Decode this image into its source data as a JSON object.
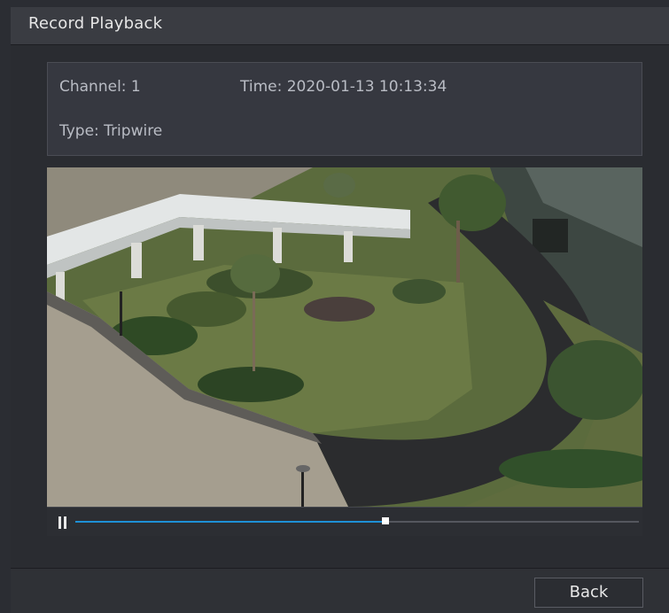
{
  "window": {
    "title": "Record Playback"
  },
  "info": {
    "channel": "Channel: 1",
    "time": "Time: 2020-01-13 10:13:34",
    "type": "Type: Tripwire"
  },
  "playback": {
    "progress": 0.55,
    "state_icon": "pause-icon",
    "accent_color": "#1e90d6"
  },
  "footer": {
    "back_label": "Back"
  }
}
